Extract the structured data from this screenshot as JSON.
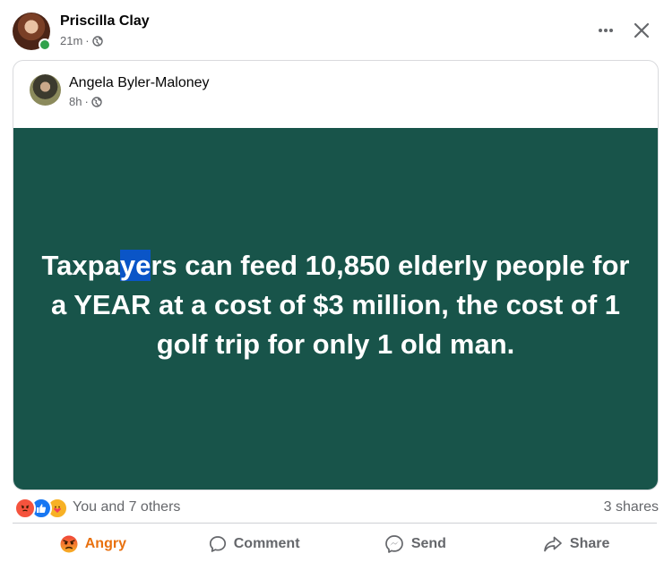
{
  "post": {
    "author": "Priscilla Clay",
    "time": "21m",
    "separator": "·",
    "shared": {
      "author": "Angela Byler-Maloney",
      "time": "8h",
      "separator": "·",
      "text_before_selection": "Taxpa",
      "text_selected": "ye",
      "text_after_selection": "rs can feed 10,850 elderly people for a YEAR at a cost of $3 million, the cost of 1 golf trip for only 1 old man.",
      "background_color": "#18544a"
    },
    "reactions_summary": "You and 7 others",
    "shares": "3 shares",
    "reaction_icons": [
      "angry",
      "like",
      "care"
    ],
    "actions": {
      "angry": "Angry",
      "comment": "Comment",
      "send": "Send",
      "share": "Share"
    },
    "colors": {
      "angry_active": "#e9710f",
      "online": "#31a24c",
      "muted": "#65676b"
    }
  }
}
